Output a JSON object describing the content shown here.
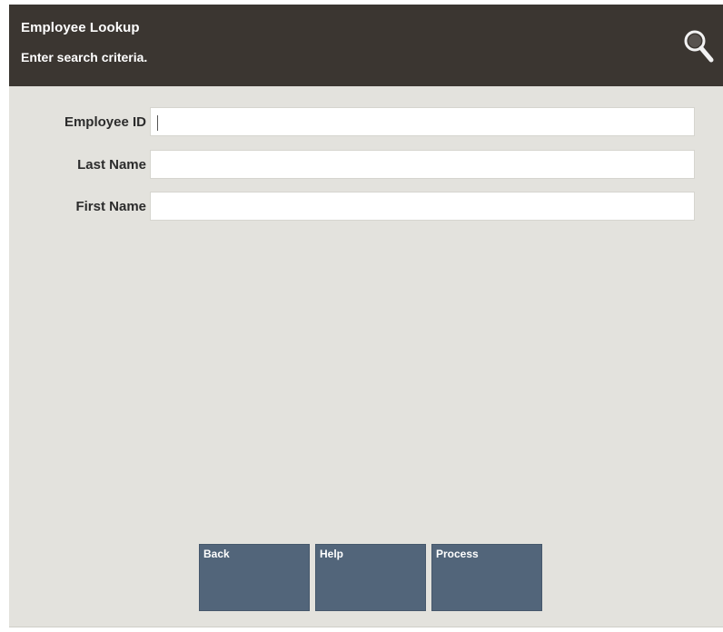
{
  "header": {
    "title": "Employee Lookup",
    "subtitle": "Enter search criteria.",
    "icon": "search-icon",
    "background_color": "#3b3631"
  },
  "form": {
    "fields": [
      {
        "label": "Employee ID",
        "value": ""
      },
      {
        "label": "Last Name",
        "value": ""
      },
      {
        "label": "First Name",
        "value": ""
      }
    ]
  },
  "buttons": [
    {
      "label": "Back"
    },
    {
      "label": "Help"
    },
    {
      "label": "Process"
    }
  ],
  "colors": {
    "panel": "#e3e2dd",
    "button": "#52657a"
  }
}
